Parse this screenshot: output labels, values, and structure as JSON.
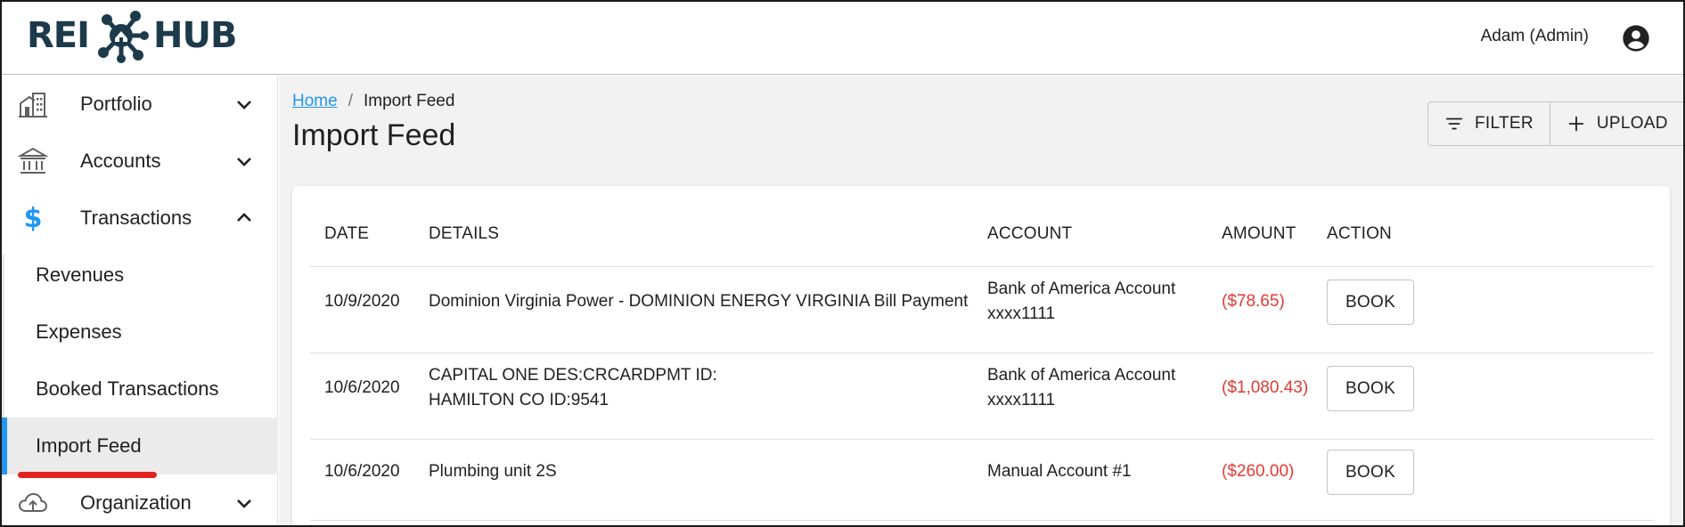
{
  "header": {
    "logo_left": "REI",
    "logo_right": "HUB",
    "user_name": "Adam (Admin)",
    "user_icon": "account-circle-icon"
  },
  "sidebar": {
    "items": [
      {
        "label": "Portfolio",
        "icon": "building-icon",
        "expanded": false
      },
      {
        "label": "Accounts",
        "icon": "bank-icon",
        "expanded": false
      },
      {
        "label": "Transactions",
        "icon": "dollar-icon",
        "expanded": true
      },
      {
        "label": "Organization",
        "icon": "cloud-upload-icon",
        "expanded": false
      }
    ],
    "sub_items": [
      {
        "label": "Revenues",
        "active": false
      },
      {
        "label": "Expenses",
        "active": false
      },
      {
        "label": "Booked Transactions",
        "active": false
      },
      {
        "label": "Import Feed",
        "active": true
      }
    ]
  },
  "breadcrumb": {
    "home": "Home",
    "separator": "/",
    "current": "Import Feed"
  },
  "page": {
    "title": "Import Feed"
  },
  "toolbar": {
    "filter_label": "FILTER",
    "upload_label": "UPLOAD"
  },
  "table": {
    "columns": [
      "DATE",
      "DETAILS",
      "ACCOUNT",
      "AMOUNT",
      "ACTION"
    ],
    "rows": [
      {
        "date": "10/9/2020",
        "details_line1": "Dominion Virginia Power - DOMINION ENERGY VIRGINIA Bill Payment",
        "details_line2": "",
        "account_line1": "Bank of America Account",
        "account_line2": "xxxx1111",
        "amount": "($78.65)",
        "action": "BOOK"
      },
      {
        "date": "10/6/2020",
        "details_line1": "CAPITAL ONE DES:CRCARDPMT ID:",
        "details_line2": "HAMILTON CO ID:9541",
        "account_line1": "Bank of America Account",
        "account_line2": "xxxx1111",
        "amount": "($1,080.43)",
        "action": "BOOK"
      },
      {
        "date": "10/6/2020",
        "details_line1": "Plumbing unit 2S",
        "details_line2": "",
        "account_line1": "Manual Account #1",
        "account_line2": "",
        "amount": "($260.00)",
        "action": "BOOK"
      }
    ]
  },
  "colors": {
    "brand": "#1c3a4a",
    "accent": "#2196f3",
    "negative_amount": "#e53935",
    "highlight_underline": "#e32222"
  }
}
